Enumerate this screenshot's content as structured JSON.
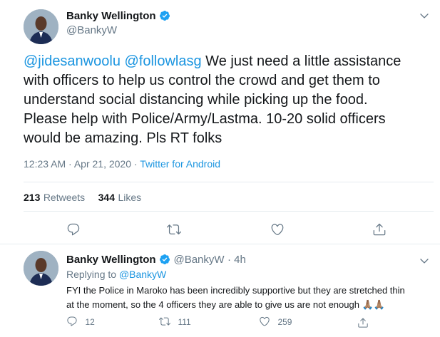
{
  "main_tweet": {
    "author_name": "Banky Wellington",
    "author_handle": "@BankyW",
    "mention_1": "@jidesanwoolu",
    "mention_2": "@followlasg",
    "text_line1_rest": " We just need a little assistance",
    "text_line2": "with officers to help us control the crowd and get them to",
    "text_line3": "understand social distancing while picking up the food.",
    "text_line4": "Please help with Police/Army/Lastma. 10-20 solid officers",
    "text_line5": "would be amazing. Pls RT folks",
    "timestamp": "12:23 AM · Apr 21, 2020 · ",
    "source": "Twitter for Android",
    "retweets_count": "213",
    "retweets_label": "Retweets",
    "likes_count": "344",
    "likes_label": "Likes"
  },
  "reply_tweet": {
    "author_name": "Banky Wellington",
    "author_handle": "@BankyW",
    "time": "· 4h",
    "replying_to_label": "Replying to ",
    "replying_to_handle": "@BankyW",
    "text_line1": "FYI the Police in Maroko has been incredibly supportive but they are stretched thin",
    "text_line2": "at the moment, so the 4 officers they are able to give us are not enough",
    "emoji": "🙏🏽🙏🏽",
    "reply_count": "12",
    "retweet_count": "111",
    "like_count": "259"
  },
  "colors": {
    "accent": "#1da1f2",
    "link": "#1b95e0",
    "muted": "#657786",
    "divider": "#e6ecf0"
  },
  "icons": [
    "verified-badge-icon",
    "chevron-down-icon",
    "reply-icon",
    "retweet-icon",
    "like-icon",
    "share-icon"
  ]
}
